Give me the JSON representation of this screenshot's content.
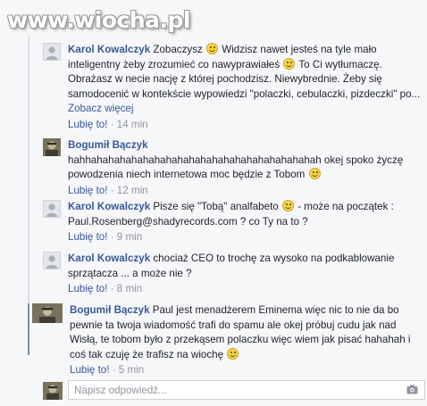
{
  "watermark": "www.wiocha.pl",
  "comments": [
    {
      "author": "Karol Kowalczyk",
      "parts": [
        "Zobaczysz",
        "Widzisz nawet jesteś na tyle mało inteligentny żeby zrozumieć co nawyprawiałeś",
        "To Ci wytłumaczę. Obrażasz w necie nację z której pochodzisz. Niewybrednie. Żeby się samodocenić w kontekście wypowiedzi \"polaczki, cebulaczki, pizdeczki\" po..."
      ],
      "more_label": "Zobacz więcej",
      "like_label": "Lubię to!",
      "time": "14 min"
    },
    {
      "author": "Bogumił Bączyk",
      "parts": [
        "hahhahahahahahahahahahahahahahahahahahahahah okej spoko życzę powodzenia niech internetowa moc będzie z Tobom"
      ],
      "like_label": "Lubię to!",
      "time": "12 min"
    },
    {
      "author": "Karol Kowalczyk",
      "parts": [
        "Pisze się \"Tobą\" analfabeto",
        "- może na początek : Paul.Rosenberg@shadyrecords.com ? co Ty na to ?"
      ],
      "like_label": "Lubię to!",
      "time": "9 min"
    },
    {
      "author": "Karol Kowalczyk",
      "parts": [
        "chociaż CEO to trochę za wysoko na podkablowanie sprzątacza ... a może nie ?"
      ],
      "like_label": "Lubię to!",
      "time": "8 min"
    },
    {
      "author": "Bogumił Bączyk",
      "parts": [
        "Paul jest menadżerem Eminema więc nic to nie da bo pewnie ta twoja wiadomość trafi do spamu ale okej próbuj cudu jak nad Wisłą, te tobom było z przekąsem polaczku więc wiem jak pisać hahahah i coś tak czuję że trafisz na wiochę"
      ],
      "like_label": "Lubię to!",
      "time": "5 min"
    }
  ],
  "reply": {
    "placeholder": "Napisz odpowiedź..."
  },
  "icons": {
    "default_avatar": "silhouette-avatar-icon",
    "photo_avatar": "user-photo-avatar",
    "emoticon": "smiley-icon",
    "camera": "camera-icon"
  },
  "colors": {
    "link": "#365899",
    "meta": "#90949c",
    "background": "#f6f7f9"
  }
}
